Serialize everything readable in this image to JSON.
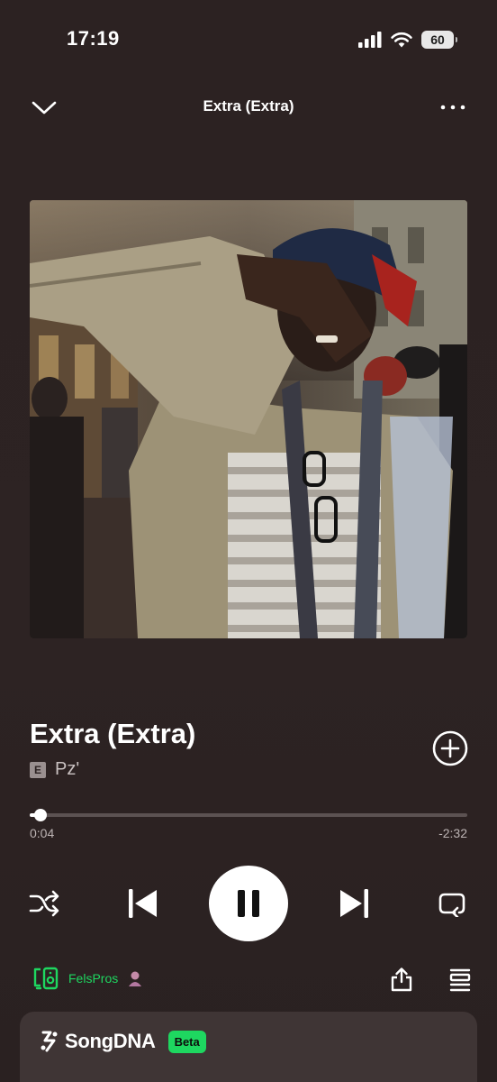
{
  "status_bar": {
    "time": "17:19",
    "battery": "60"
  },
  "header": {
    "title": "Extra (Extra)"
  },
  "track": {
    "title": "Extra (Extra)",
    "explicit_label": "E",
    "artist": "Pz'"
  },
  "progress": {
    "elapsed": "0:04",
    "remaining": "-2:32",
    "fraction": 0.025
  },
  "device": {
    "name": "FelsPros"
  },
  "songdna": {
    "label": "SongDNA",
    "badge": "Beta"
  },
  "colors": {
    "accent": "#1ed760",
    "background": "#2c2222",
    "card": "#3f3535"
  },
  "icons": [
    "chevron-down-icon",
    "more-icon",
    "plus-circle-icon",
    "shuffle-icon",
    "previous-icon",
    "pause-icon",
    "next-icon",
    "repeat-icon",
    "connect-device-icon",
    "share-icon",
    "queue-icon",
    "songdna-icon",
    "cellular-icon",
    "wifi-icon",
    "battery-icon"
  ]
}
